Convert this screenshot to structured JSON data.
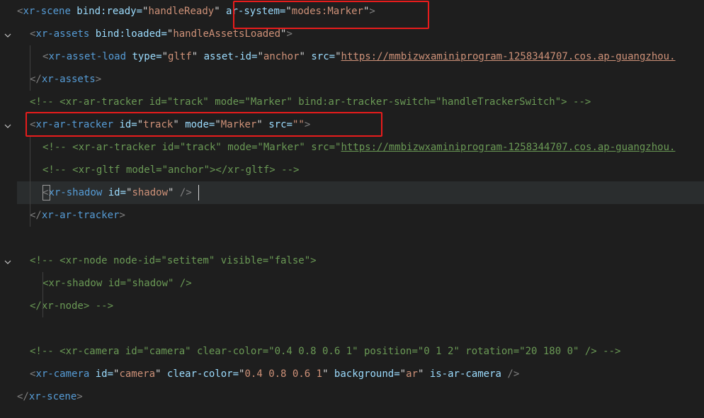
{
  "colors": {
    "background": "#1e1e1e",
    "tag": "#569cd6",
    "attribute": "#9cdcfe",
    "plain": "#d4d4d4",
    "string": "#ce9178",
    "comment": "#6a9955",
    "punctuation": "#808080",
    "red_box": "#e81c1c"
  },
  "icons": {
    "fold_marker": "chevron-down-icon"
  },
  "lines": [
    {
      "tokens": [
        {
          "t": "<",
          "c": "punctuation"
        },
        {
          "t": "xr-scene",
          "c": "tag"
        },
        {
          "t": " bind:ready=",
          "c": "attribute"
        },
        {
          "t": "\"",
          "c": "plain"
        },
        {
          "t": "handleReady",
          "c": "string"
        },
        {
          "t": "\"",
          "c": "plain"
        },
        {
          "t": " ar-system=",
          "c": "attribute"
        },
        {
          "t": "\"",
          "c": "plain"
        },
        {
          "t": "modes:Marker",
          "c": "string"
        },
        {
          "t": "\"",
          "c": "plain"
        },
        {
          "t": ">",
          "c": "punctuation"
        }
      ]
    },
    {
      "tokens": [
        {
          "t": "<",
          "c": "punctuation"
        },
        {
          "t": "xr-assets",
          "c": "tag"
        },
        {
          "t": " bind:loaded=",
          "c": "attribute"
        },
        {
          "t": "\"",
          "c": "plain"
        },
        {
          "t": "handleAssetsLoaded",
          "c": "string"
        },
        {
          "t": "\"",
          "c": "plain"
        },
        {
          "t": ">",
          "c": "punctuation"
        }
      ]
    },
    {
      "tokens": [
        {
          "t": "<",
          "c": "punctuation"
        },
        {
          "t": "xr-asset-load",
          "c": "tag"
        },
        {
          "t": " type=",
          "c": "attribute"
        },
        {
          "t": "\"",
          "c": "plain"
        },
        {
          "t": "gltf",
          "c": "string"
        },
        {
          "t": "\"",
          "c": "plain"
        },
        {
          "t": " asset-id=",
          "c": "attribute"
        },
        {
          "t": "\"",
          "c": "plain"
        },
        {
          "t": "anchor",
          "c": "string"
        },
        {
          "t": "\"",
          "c": "plain"
        },
        {
          "t": " src=",
          "c": "attribute"
        },
        {
          "t": "\"",
          "c": "plain"
        },
        {
          "t": "https://mmbizwxaminiprogram-1258344707.cos.ap-guangzhou.",
          "c": "string",
          "u": true
        }
      ]
    },
    {
      "tokens": [
        {
          "t": "</",
          "c": "punctuation"
        },
        {
          "t": "xr-assets",
          "c": "tag"
        },
        {
          "t": ">",
          "c": "punctuation"
        }
      ]
    },
    {
      "tokens": [
        {
          "t": "<!-- <xr-ar-tracker id=\"track\" mode=\"Marker\" bind:ar-tracker-switch=\"handleTrackerSwitch\"> -->",
          "c": "comment"
        }
      ]
    },
    {
      "tokens": [
        {
          "t": "<",
          "c": "punctuation"
        },
        {
          "t": "xr-ar-tracker",
          "c": "tag"
        },
        {
          "t": " id=",
          "c": "attribute"
        },
        {
          "t": "\"",
          "c": "plain"
        },
        {
          "t": "track",
          "c": "string"
        },
        {
          "t": "\"",
          "c": "plain"
        },
        {
          "t": " mode=",
          "c": "attribute"
        },
        {
          "t": "\"",
          "c": "plain"
        },
        {
          "t": "Marker",
          "c": "string"
        },
        {
          "t": "\"",
          "c": "plain"
        },
        {
          "t": " src=",
          "c": "attribute"
        },
        {
          "t": "\"\"",
          "c": "string"
        },
        {
          "t": ">",
          "c": "punctuation"
        }
      ]
    },
    {
      "tokens": [
        {
          "t": "<!-- <xr-ar-tracker id=\"track\" mode=\"Marker\" src=\"",
          "c": "comment"
        },
        {
          "t": "https://mmbizwxaminiprogram-1258344707.cos.ap-guangzhou.",
          "c": "comment",
          "u": true
        }
      ]
    },
    {
      "tokens": [
        {
          "t": "<!-- <xr-gltf model=\"anchor\"></xr-gltf> -->",
          "c": "comment"
        }
      ]
    },
    {
      "tokens": [
        {
          "t": "<",
          "c": "punctuation"
        },
        {
          "t": "xr-shadow",
          "c": "tag"
        },
        {
          "t": " id=",
          "c": "attribute"
        },
        {
          "t": "\"",
          "c": "plain"
        },
        {
          "t": "shadow",
          "c": "string"
        },
        {
          "t": "\"",
          "c": "plain"
        },
        {
          "t": " />",
          "c": "punctuation"
        }
      ]
    },
    {
      "tokens": [
        {
          "t": "</",
          "c": "punctuation"
        },
        {
          "t": "xr-ar-tracker",
          "c": "tag"
        },
        {
          "t": ">",
          "c": "punctuation"
        }
      ]
    },
    {
      "tokens": []
    },
    {
      "tokens": [
        {
          "t": "<!-- <xr-node node-id=\"setitem\" visible=\"false\">",
          "c": "comment"
        }
      ]
    },
    {
      "tokens": [
        {
          "t": "<xr-shadow id=\"shadow\" />",
          "c": "comment"
        }
      ]
    },
    {
      "tokens": [
        {
          "t": "</xr-node> -->",
          "c": "comment"
        }
      ]
    },
    {
      "tokens": []
    },
    {
      "tokens": [
        {
          "t": "<!-- <xr-camera id=\"camera\" clear-color=\"0.4 0.8 0.6 1\" position=\"0 1 2\" rotation=\"20 180 0\" /> -->",
          "c": "comment"
        }
      ]
    },
    {
      "tokens": [
        {
          "t": "<",
          "c": "punctuation"
        },
        {
          "t": "xr-camera",
          "c": "tag"
        },
        {
          "t": " id=",
          "c": "attribute"
        },
        {
          "t": "\"",
          "c": "plain"
        },
        {
          "t": "camera",
          "c": "string"
        },
        {
          "t": "\"",
          "c": "plain"
        },
        {
          "t": " clear-color=",
          "c": "attribute"
        },
        {
          "t": "\"",
          "c": "plain"
        },
        {
          "t": "0.4 0.8 0.6 1",
          "c": "string"
        },
        {
          "t": "\"",
          "c": "plain"
        },
        {
          "t": " background=",
          "c": "attribute"
        },
        {
          "t": "\"",
          "c": "plain"
        },
        {
          "t": "ar",
          "c": "string"
        },
        {
          "t": "\"",
          "c": "plain"
        },
        {
          "t": " is-ar-camera",
          "c": "attribute"
        },
        {
          "t": " />",
          "c": "punctuation"
        }
      ]
    },
    {
      "tokens": [
        {
          "t": "</",
          "c": "punctuation"
        },
        {
          "t": "xr-scene",
          "c": "tag"
        },
        {
          "t": ">",
          "c": "punctuation"
        }
      ]
    }
  ]
}
